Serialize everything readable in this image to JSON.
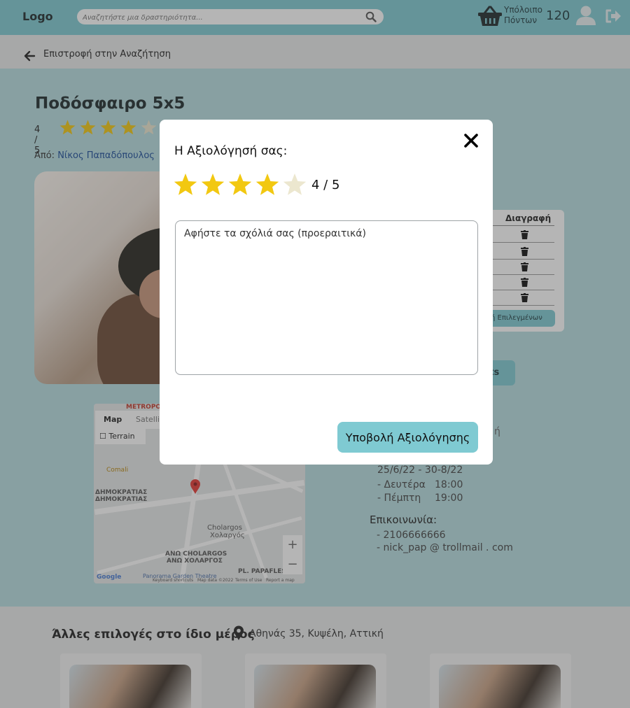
{
  "header": {
    "logo": "Logo",
    "search_placeholder": "Αναζητήστε μια δραστηριότητα...",
    "points_label_line1": "Υπόλοιπο",
    "points_label_line2": "Πόντων",
    "points_value": "120"
  },
  "back": {
    "label": "Επιστροφή στην Αναζήτηση"
  },
  "activity": {
    "title": "Ποδόσφαιρο 5x5",
    "rating_text": "4 / 5",
    "rating_value": 4,
    "author_prefix": "Από:",
    "author_name": "Νίκος Παπαδόπουλος"
  },
  "bookings_table": {
    "delete_header": "Διαγραφή",
    "delete_selected_label": "ή Επιλεγμένων",
    "row_count": 5
  },
  "events_button": {
    "label": "nts"
  },
  "map": {
    "tab_map": "Map",
    "tab_satellite": "Satellite",
    "terrain": "Terrain",
    "zoom_in": "+",
    "zoom_out": "−",
    "labels": [
      "METROPOL",
      "Comali",
      "ΔΗΜΟΚΡΑΤΙΑΣ",
      "ΔΗΜΟΚΡΑΤΙΑΣ",
      "Cholargos",
      "Χολαργός",
      "ΑΝΩ CHOLARGOS",
      "ΑΝΩ ΧΟΛΑΡΓΟΣ",
      "PL. PAPAFLES",
      "Google",
      "Keyboard shortcuts",
      "Map data ©2022",
      "Terms of Use",
      "Report a map error",
      "Panorama Garden Theatre"
    ]
  },
  "info": {
    "partial_right": "ή",
    "dates": "25/6/22 - 30-8/22",
    "schedule": [
      {
        "day": "- Δευτέρα",
        "time": "18:00"
      },
      {
        "day": "- Πέμπτη",
        "time": "19:00"
      }
    ],
    "contact_title": "Επικοινωνία:",
    "phone": "- 2106666666",
    "email": "- nick_pap @ trollmail . com"
  },
  "other": {
    "title": "Άλλες επιλογές στο ίδιο μέρος",
    "address": "Αθηνάς 35, Κυψέλη, Αττική"
  },
  "modal": {
    "title": "Η Αξιολόγησή σας:",
    "rating_value": 4,
    "rating_max": 5,
    "score": "4 / 5",
    "comment_placeholder": "Αφήστε τα σχόλιά σας (προεραιτικά)",
    "submit": "Υποβολή Αξιολόγησης"
  },
  "colors": {
    "accent": "#7fcad2",
    "star_filled": "#f2c811",
    "star_empty": "#ece7cf",
    "link": "#1a4d9a"
  }
}
